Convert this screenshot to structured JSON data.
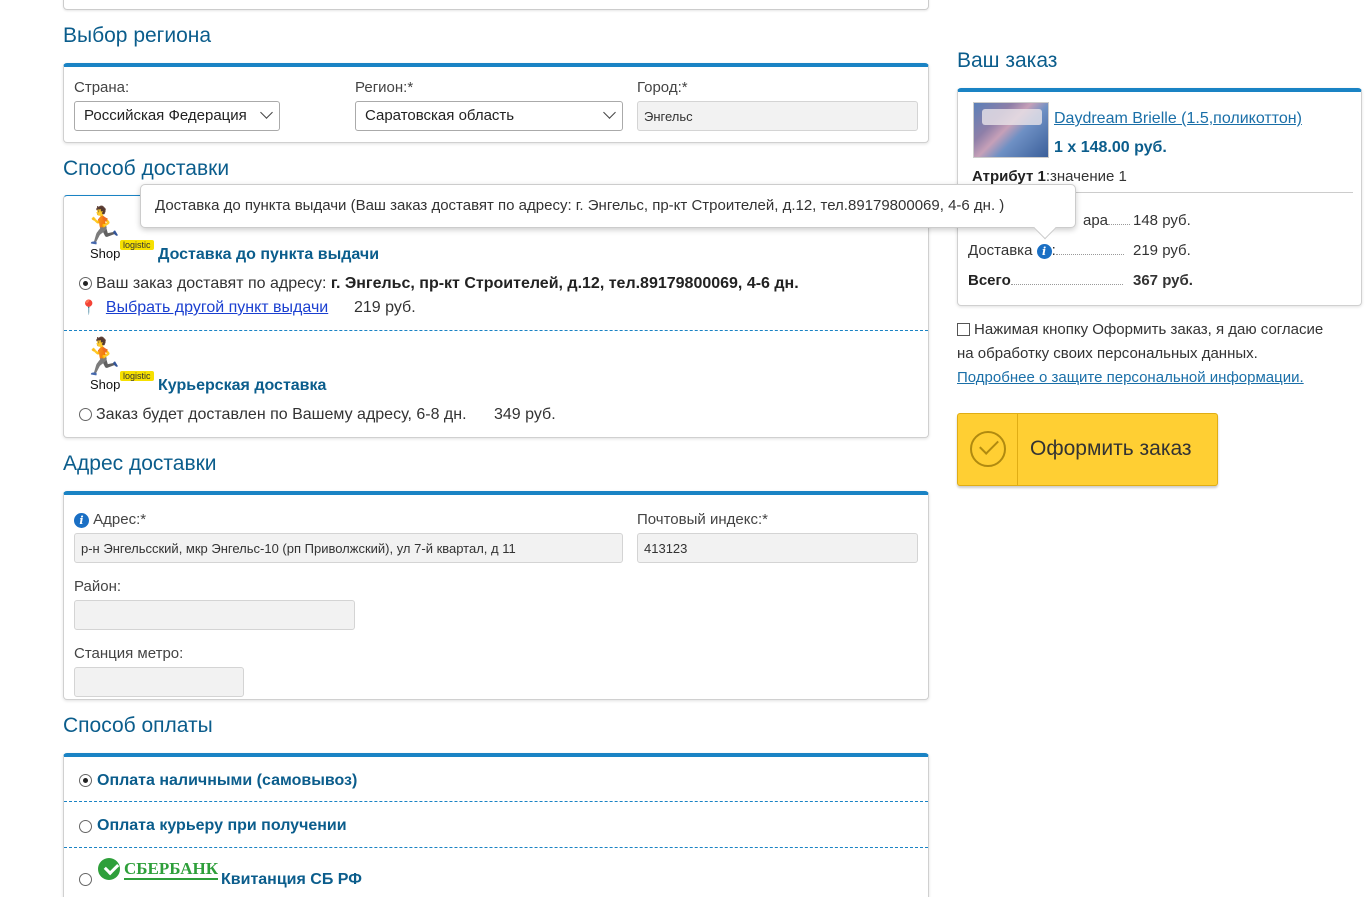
{
  "region": {
    "title": "Выбор региона",
    "country_label": "Страна:",
    "country_value": "Российская Федерация",
    "region_label": "Регион:*",
    "region_value": "Саратовская область",
    "city_label": "Город:*",
    "city_value": "Энгельс"
  },
  "delivery": {
    "title": "Способ доставки",
    "tooltip": "Доставка до пункта выдачи (Ваш заказ доставят по адресу: г. Энгельс, пр-кт Строителей, д.12, тел.89179800069, 4-6 дн. )",
    "logo_shop": "Shop",
    "logo_logistic": "logistic",
    "options": [
      {
        "name": "Доставка до пункта выдачи",
        "desc_prefix": "Ваш заказ доставят по адресу:",
        "desc_bold": "г. Энгельс, пр-кт Строителей, д.12, тел.89179800069, 4-6 дн.",
        "change_link": "Выбрать другой пункт выдачи",
        "price": "219 руб."
      },
      {
        "name": "Курьерская доставка",
        "desc": "Заказ будет доставлен по Вашему адресу, 6-8 дн.",
        "price": "349 руб."
      }
    ]
  },
  "address": {
    "title": "Адрес доставки",
    "address_label": "Адрес:*",
    "address_value": "р-н Энгельсский, мкр Энгельс-10 (рп Приволжский), ул 7-й квартал, д 11",
    "zip_label": "Почтовый индекс:*",
    "zip_value": "413123",
    "district_label": "Район:",
    "district_value": "",
    "metro_label": "Станция метро:",
    "metro_value": ""
  },
  "payment": {
    "title": "Способ оплаты",
    "options": [
      {
        "name": "Оплата наличными (самовывоз)"
      },
      {
        "name": "Оплата курьеру при получении"
      },
      {
        "name": "Квитанция СБ РФ",
        "logo": "СБЕРБАНК"
      }
    ]
  },
  "order": {
    "title": "Ваш заказ",
    "product_name": "Daydream Brielle (1.5,поликоттон)",
    "product_qty_price": "1 x 148.00 руб.",
    "attr_label": "Атрибут 1",
    "attr_value": ":значение 1",
    "goods_label": "Стоимость товара",
    "goods_label_visible": "ара",
    "goods_value": "148 руб.",
    "delivery_label": "Доставка",
    "delivery_value": "219 руб.",
    "total_label": "Всего",
    "total_value": "367 руб."
  },
  "consent": {
    "text1": "Нажимая кнопку Оформить заказ, я даю согласие",
    "text2": "на обработку своих персональных данных.",
    "link": "Подробнее о защите персональной информации."
  },
  "submit_label": "Оформить заказ",
  "colors": {
    "accent": "#1a83c4",
    "title": "#0b5d8c",
    "button": "#ffcf33",
    "sber": "#2e9f3a"
  }
}
